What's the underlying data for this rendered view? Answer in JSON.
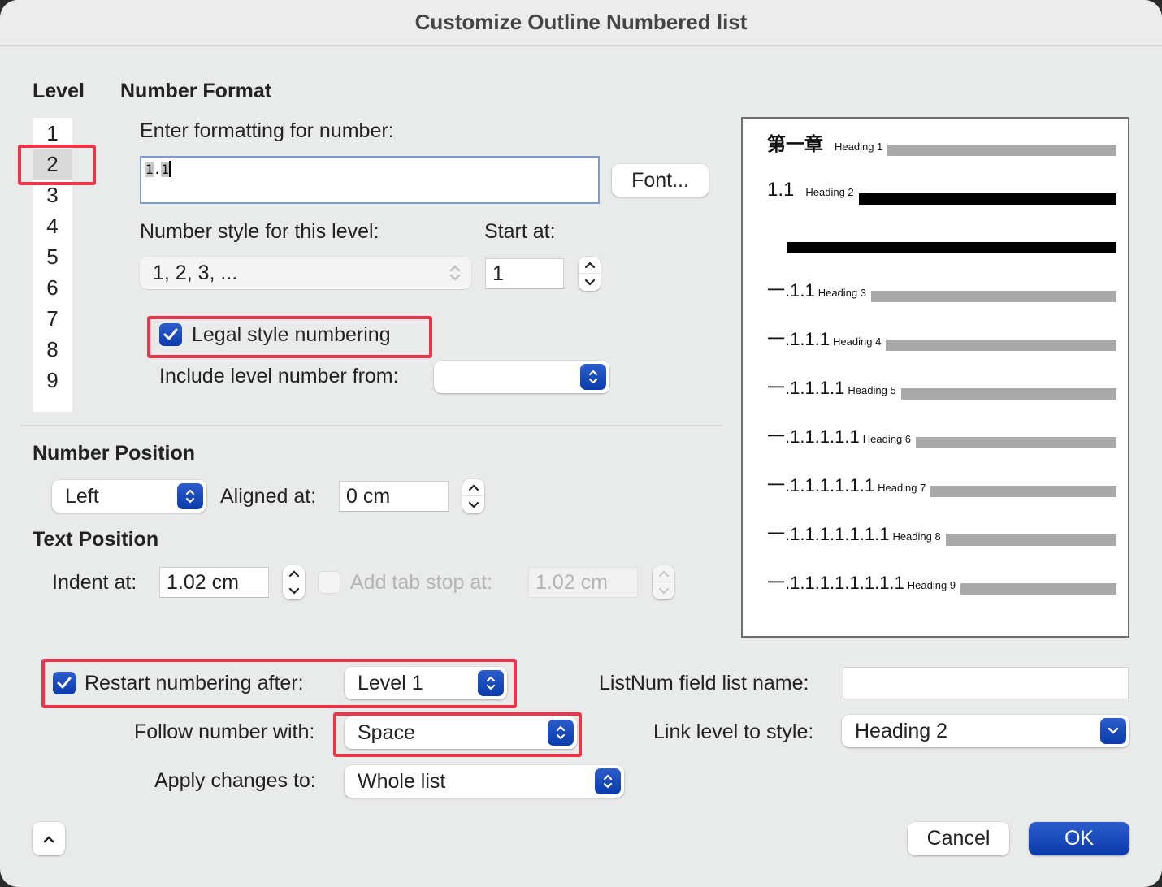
{
  "window": {
    "title": "Customize Outline Numbered list"
  },
  "level": {
    "header": "Level",
    "items": [
      "1",
      "2",
      "3",
      "4",
      "5",
      "6",
      "7",
      "8",
      "9"
    ],
    "selected": "2"
  },
  "number_format": {
    "header": "Number Format",
    "format_label": "Enter formatting for number:",
    "format_value_parts": [
      "1",
      ".",
      "1"
    ],
    "format_value": "1.1",
    "font_button": "Font...",
    "style_label": "Number style for this level:",
    "style_value": "1, 2, 3, ...",
    "start_label": "Start at:",
    "start_value": "1",
    "legal_label": "Legal style numbering",
    "legal_checked": true,
    "include_label": "Include level number from:",
    "include_value": ""
  },
  "number_position": {
    "header": "Number Position",
    "alignment_value": "Left",
    "aligned_label": "Aligned at:",
    "aligned_value": "0 cm"
  },
  "text_position": {
    "header": "Text Position",
    "indent_label": "Indent at:",
    "indent_value": "1.02 cm",
    "tabstop_label": "Add tab stop at:",
    "tabstop_checked": false,
    "tabstop_value": "1.02 cm"
  },
  "preview": {
    "rows": [
      {
        "number": "第一章",
        "heading": "Heading 1"
      },
      {
        "number": "1.1",
        "heading": "Heading 2"
      },
      {
        "number": "一.1.1",
        "heading": "Heading 3"
      },
      {
        "number": "一.1.1.1",
        "heading": "Heading 4"
      },
      {
        "number": "一.1.1.1.1",
        "heading": "Heading 5"
      },
      {
        "number": "一.1.1.1.1.1",
        "heading": "Heading 6"
      },
      {
        "number": "一.1.1.1.1.1.1",
        "heading": "Heading 7"
      },
      {
        "number": "一.1.1.1.1.1.1.1",
        "heading": "Heading 8"
      },
      {
        "number": "一.1.1.1.1.1.1.1.1",
        "heading": "Heading 9"
      }
    ]
  },
  "options": {
    "restart_label": "Restart numbering after:",
    "restart_checked": true,
    "restart_value": "Level 1",
    "follow_label": "Follow number with:",
    "follow_value": "Space",
    "apply_label": "Apply changes to:",
    "apply_value": "Whole list",
    "listnum_label": "ListNum field list name:",
    "listnum_value": "",
    "link_label": "Link level to style:",
    "link_value": "Heading 2"
  },
  "footer": {
    "collapse_icon": "chevron-up-icon",
    "cancel": "Cancel",
    "ok": "OK"
  },
  "colors": {
    "accent": "#1a4bbd",
    "highlight_box": "#f0344a"
  }
}
